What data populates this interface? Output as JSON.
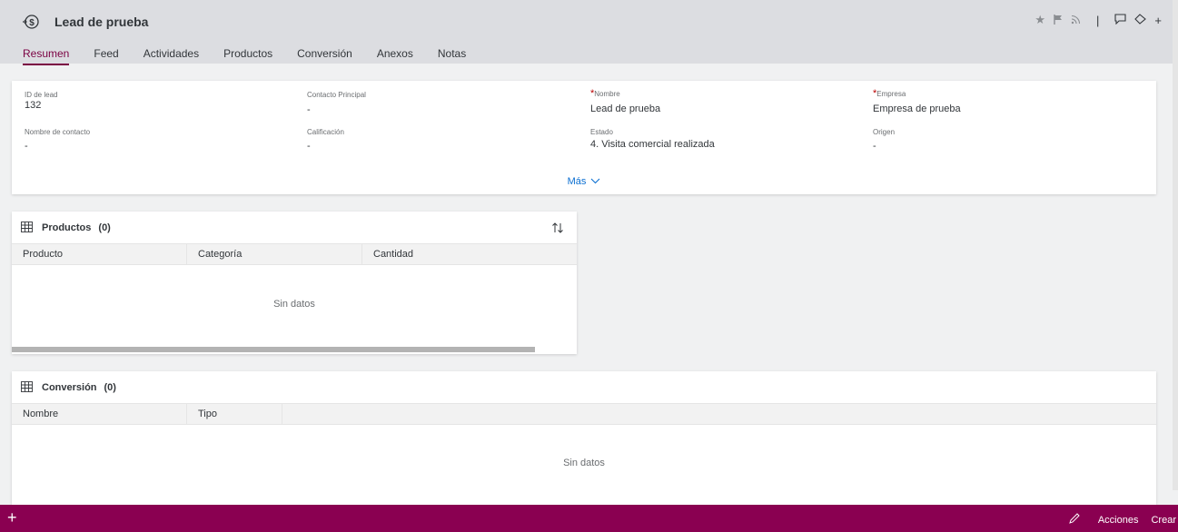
{
  "header": {
    "title": "Lead de prueba",
    "object_icon": "lead-money-icon",
    "actions": [
      "star-icon",
      "flag-icon",
      "rss-icon",
      "comment-icon",
      "tag-icon",
      "add-icon"
    ],
    "separator": "|",
    "add_symbol": "+"
  },
  "tabs": [
    {
      "label": "Resumen",
      "active": true
    },
    {
      "label": "Feed"
    },
    {
      "label": "Actividades"
    },
    {
      "label": "Productos"
    },
    {
      "label": "Conversión"
    },
    {
      "label": "Anexos"
    },
    {
      "label": "Notas"
    }
  ],
  "fields": [
    {
      "label": "ID de lead",
      "value": "132",
      "required": false
    },
    {
      "label": "Contacto Principal",
      "value": "-",
      "required": false
    },
    {
      "label": "Nombre",
      "value": "Lead de prueba",
      "required": true
    },
    {
      "label": "Empresa",
      "value": "Empresa de prueba",
      "required": true
    },
    {
      "label": "Nombre de contacto",
      "value": "-",
      "required": false
    },
    {
      "label": "Calificación",
      "value": "-",
      "required": false
    },
    {
      "label": "Estado",
      "value": "4. Visita comercial realizada",
      "required": false
    },
    {
      "label": "Origen",
      "value": "-",
      "required": false
    }
  ],
  "required_mark": "*",
  "more_label": "Más",
  "productos": {
    "title": "Productos",
    "count": "(0)",
    "columns": [
      "Producto",
      "Categoría",
      "Cantidad"
    ],
    "empty": "Sin datos"
  },
  "conversion": {
    "title": "Conversión",
    "count": "(0)",
    "columns": [
      "Nombre",
      "Tipo"
    ],
    "empty": "Sin datos"
  },
  "footer": {
    "add_symbol": "+",
    "actions_label": "Acciones",
    "create_label": "Crear"
  },
  "colors": {
    "accent": "#7a0042",
    "footer_bg": "#8a0051",
    "link": "#0a6ed1",
    "required": "#bb0000"
  }
}
